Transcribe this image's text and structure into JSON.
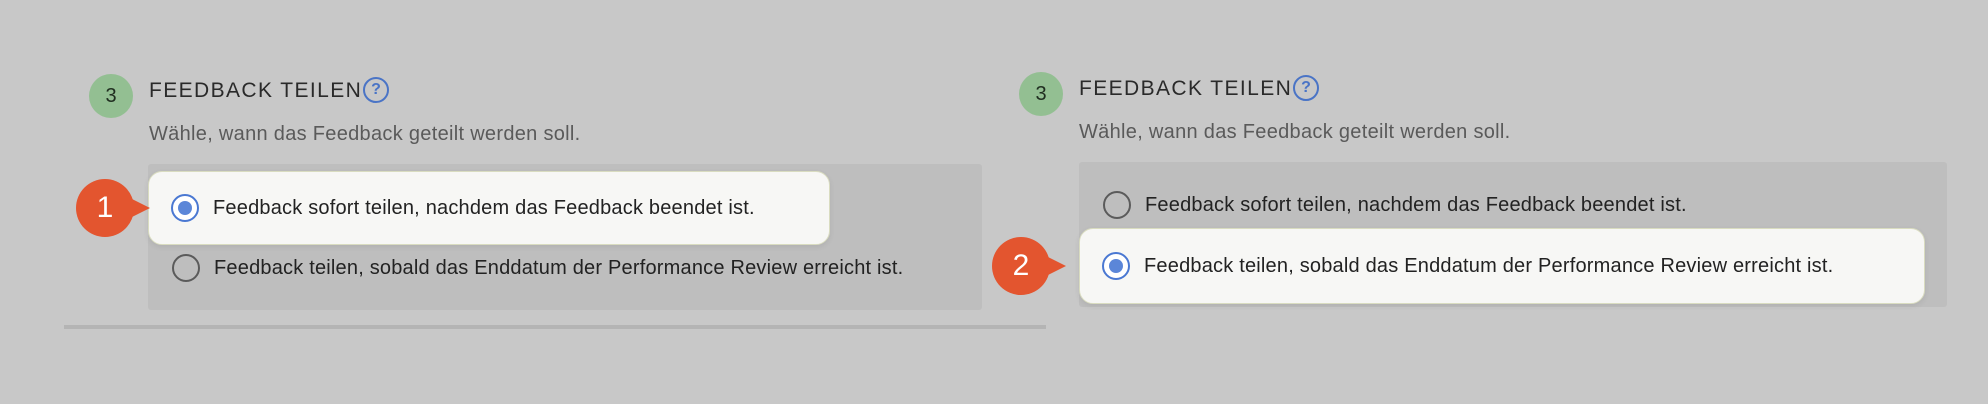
{
  "left_panel": {
    "step_number": "3",
    "title": "FEEDBACK TEILEN",
    "help_glyph": "?",
    "description": "Wähle, wann das Feedback geteilt werden soll.",
    "options": [
      {
        "label": "Feedback sofort teilen, nachdem das Feedback beendet ist.",
        "selected": true
      },
      {
        "label": "Feedback teilen, sobald das Enddatum der Performance Review erreicht ist.",
        "selected": false
      }
    ],
    "callout_number": "1"
  },
  "right_panel": {
    "step_number": "3",
    "title": "FEEDBACK TEILEN",
    "help_glyph": "?",
    "description": "Wähle, wann das Feedback geteilt werden soll.",
    "options": [
      {
        "label": "Feedback sofort teilen, nachdem das Feedback beendet ist.",
        "selected": false
      },
      {
        "label": "Feedback teilen, sobald das Enddatum der Performance Review erreicht ist.",
        "selected": true
      }
    ],
    "callout_number": "2"
  },
  "colors": {
    "background": "#c8c8c8",
    "step_badge": "#93bf92",
    "help_icon": "#4a74c6",
    "radio_selected": "#5b86d8",
    "callout": "#e3552f"
  },
  "icons": {
    "help": "question-circle-icon",
    "radio_on": "radio-checked-icon",
    "radio_off": "radio-unchecked-icon"
  }
}
